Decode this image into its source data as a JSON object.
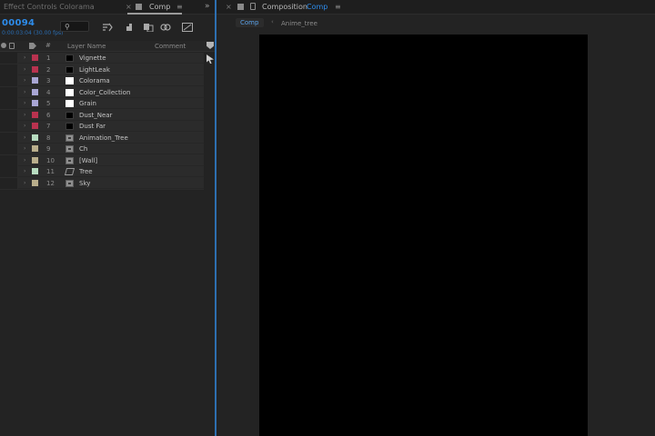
{
  "left_panel": {
    "tab_effects_label": "Effect Controls Colorama",
    "tab_close": "×",
    "tab_comp_label": "Comp",
    "tab_menu": "≡",
    "expand": "»",
    "timecode": "00094",
    "timecode_sub": "0:00:03:04 (30.00 fps)",
    "columns": {
      "number": "#",
      "layer_name": "Layer Name",
      "comment": "Comment"
    },
    "layers": [
      {
        "num": "1",
        "name": "Vignette",
        "color": "#b8324f",
        "thumb": "black"
      },
      {
        "num": "2",
        "name": "LightLeak",
        "color": "#b8324f",
        "thumb": "black"
      },
      {
        "num": "3",
        "name": "Colorama",
        "color": "#a9a6d4",
        "thumb": "white"
      },
      {
        "num": "4",
        "name": "Color_Collection",
        "color": "#a9a6d4",
        "thumb": "white"
      },
      {
        "num": "5",
        "name": "Grain",
        "color": "#a9a6d4",
        "thumb": "white"
      },
      {
        "num": "6",
        "name": "Dust_Near",
        "color": "#b8324f",
        "thumb": "black"
      },
      {
        "num": "7",
        "name": "Dust Far",
        "color": "#b8324f",
        "thumb": "black"
      },
      {
        "num": "8",
        "name": "Animation_Tree",
        "color": "#b7dcc0",
        "thumb": "comp"
      },
      {
        "num": "9",
        "name": "Ch",
        "color": "#b9ae8c",
        "thumb": "comp"
      },
      {
        "num": "10",
        "name": "[Wall]",
        "color": "#b9ae8c",
        "thumb": "comp"
      },
      {
        "num": "11",
        "name": "Tree",
        "color": "#b7dcc0",
        "thumb": "shape"
      },
      {
        "num": "12",
        "name": "Sky",
        "color": "#b9ae8c",
        "thumb": "comp"
      }
    ]
  },
  "right_panel": {
    "tab_close": "×",
    "tab_label": "Composition",
    "tab_comp_name": "Comp",
    "tab_menu": "≡",
    "breadcrumb": [
      "Comp",
      "Anime_tree"
    ],
    "breadcrumb_sep": "‹"
  },
  "colors": {
    "accent": "#2d8ceb",
    "viewer_bg": "#000000",
    "panel_bg": "#232323"
  },
  "icons": {
    "search": "search-icon",
    "draft_3d": "draft-3d-icon",
    "shy": "shy-layers-icon",
    "frame_blend": "frame-blending-icon",
    "motion_blur": "motion-blur-icon",
    "graph": "graph-editor-icon"
  }
}
